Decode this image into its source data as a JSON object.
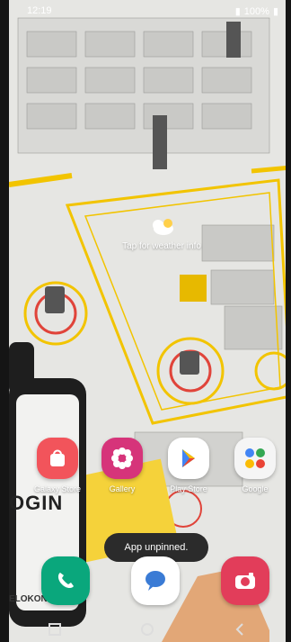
{
  "status": {
    "time": "12:19",
    "battery": "100%"
  },
  "weather": {
    "label": "Tap for weather info"
  },
  "apps": [
    {
      "label": "Galaxy Store",
      "color": "#f2545b",
      "icon": "bag-icon"
    },
    {
      "label": "Gallery",
      "color": "#d6347a",
      "icon": "flower-icon"
    },
    {
      "label": "Play Store",
      "color": "#ffffff",
      "icon": "play-store-icon"
    },
    {
      "label": "Google",
      "color": "#f5f5f5",
      "icon": "google-folder-icon"
    }
  ],
  "toast": {
    "text": "App unpinned."
  },
  "background_text": {
    "login": "OGIN",
    "brand": "ELOKON"
  },
  "dock": [
    {
      "name": "phone",
      "color": "#0aa77c",
      "icon": "phone-icon"
    },
    {
      "name": "messages",
      "color": "#ffffff",
      "icon": "message-icon"
    },
    {
      "name": "camera",
      "color": "#e23d5a",
      "icon": "camera-icon"
    }
  ]
}
